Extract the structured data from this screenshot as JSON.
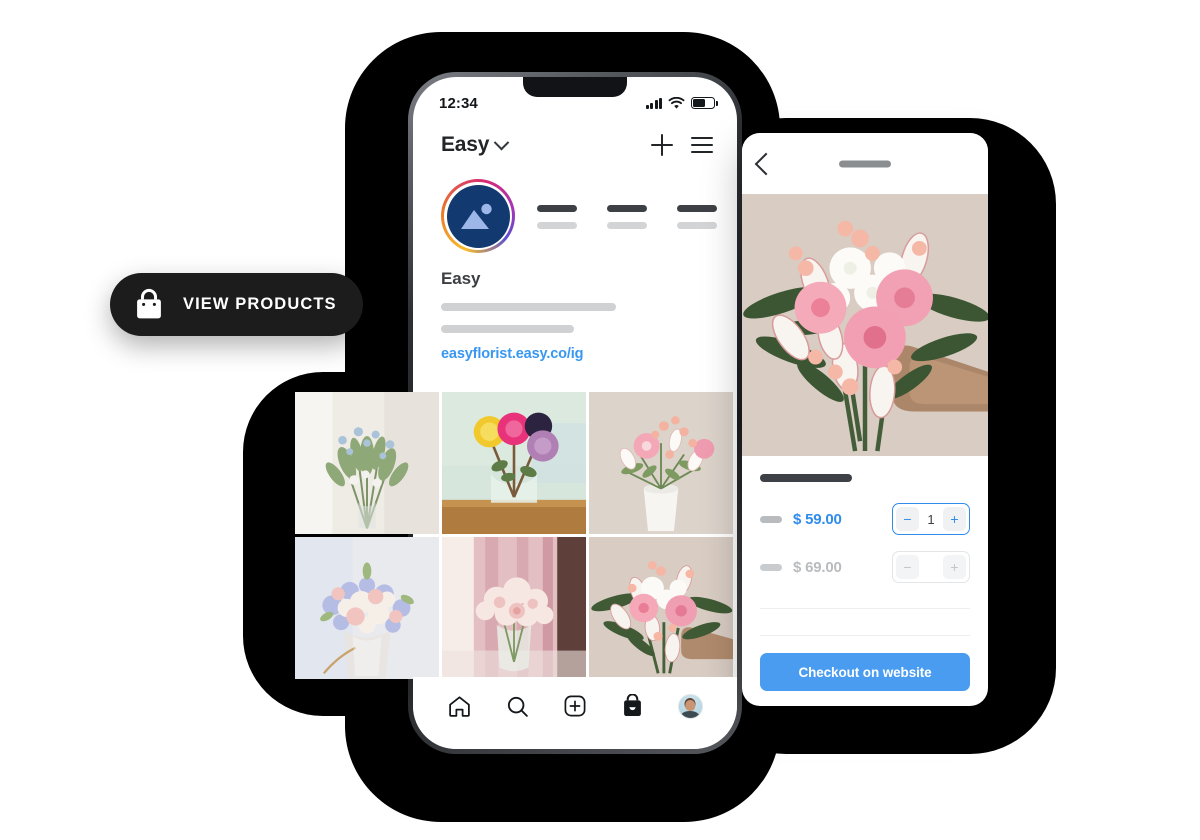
{
  "badge": {
    "label": "VIEW PRODUCTS",
    "icon": "shopping-bag-icon",
    "background": "#1c1c1c",
    "text_color": "#ffffff"
  },
  "phone": {
    "status_bar": {
      "time": "12:34",
      "icons": [
        "cellular-signal-icon",
        "wifi-icon",
        "battery-icon"
      ],
      "battery_level": "62%"
    },
    "app_header": {
      "username": "Easy",
      "dropdown_icon": "chevron-down-icon",
      "actions": [
        {
          "name": "add-post-button",
          "icon": "plus-icon"
        },
        {
          "name": "menu-button",
          "icon": "hamburger-icon"
        }
      ]
    },
    "profile": {
      "avatar_icon": "image-placeholder-icon",
      "avatar_ring": "instagram-gradient",
      "avatar_bg": "#123a70",
      "stats": [
        {
          "name": "posts"
        },
        {
          "name": "followers"
        },
        {
          "name": "following"
        }
      ],
      "display_name": "Easy",
      "bio_placeholder_lines": 2,
      "website": "easyflorist.easy.co/ig",
      "website_color": "#3897f0"
    },
    "grid": {
      "photos": [
        {
          "alt": "white and blue wildflowers in glass vase by window",
          "palette": [
            "#eeeae4",
            "#c9cfbe",
            "#8aa07a"
          ]
        },
        {
          "alt": "yellow rose, pink carnation and purple dahlia in jar on wooden table",
          "palette": [
            "#d9e8df",
            "#f5d63c",
            "#e8417c"
          ]
        },
        {
          "alt": "pink gerbera and white tulips in white vase",
          "palette": [
            "#dcd3cb",
            "#f3aab6",
            "#ffffff"
          ]
        },
        {
          "alt": "pastel blue and peach bouquet in glass vase",
          "palette": [
            "#e6e8ee",
            "#b9bfe4",
            "#f3c9c2"
          ]
        },
        {
          "alt": "cream roses in glass jar against pink curtain",
          "palette": [
            "#e7c9cb",
            "#f6e3dd",
            "#d79aa0"
          ]
        },
        {
          "alt": "hand holding pink gerbera and white bouquet",
          "palette": [
            "#d8ccc3",
            "#f2a7b4",
            "#3f5a35"
          ]
        }
      ]
    },
    "bottom_nav": [
      {
        "name": "nav-home",
        "icon": "home-icon"
      },
      {
        "name": "nav-search",
        "icon": "search-icon"
      },
      {
        "name": "nav-create",
        "icon": "plus-square-icon"
      },
      {
        "name": "nav-shop",
        "icon": "shopping-bag-filled-icon"
      },
      {
        "name": "nav-profile",
        "icon": "avatar-icon"
      }
    ]
  },
  "product_panel": {
    "header": {
      "back_icon": "chevron-left-icon",
      "title_placeholder": true
    },
    "hero": {
      "alt": "hand holding bouquet of pink gerberas, white tulips and eucalyptus",
      "background": "#d8ccc3"
    },
    "product_title_placeholder": true,
    "variants": [
      {
        "label_placeholder": true,
        "price": "$ 59.00",
        "selected": true,
        "price_color": "#2f8ceb",
        "quantity": "1",
        "decrement_label": "−",
        "increment_label": "+"
      },
      {
        "label_placeholder": true,
        "price": "$ 69.00",
        "selected": false,
        "price_color": "#b9bcbe",
        "quantity": "",
        "decrement_label": "−",
        "increment_label": "+"
      }
    ],
    "checkout": {
      "label": "Checkout on website",
      "background": "#4a9cf0"
    }
  }
}
